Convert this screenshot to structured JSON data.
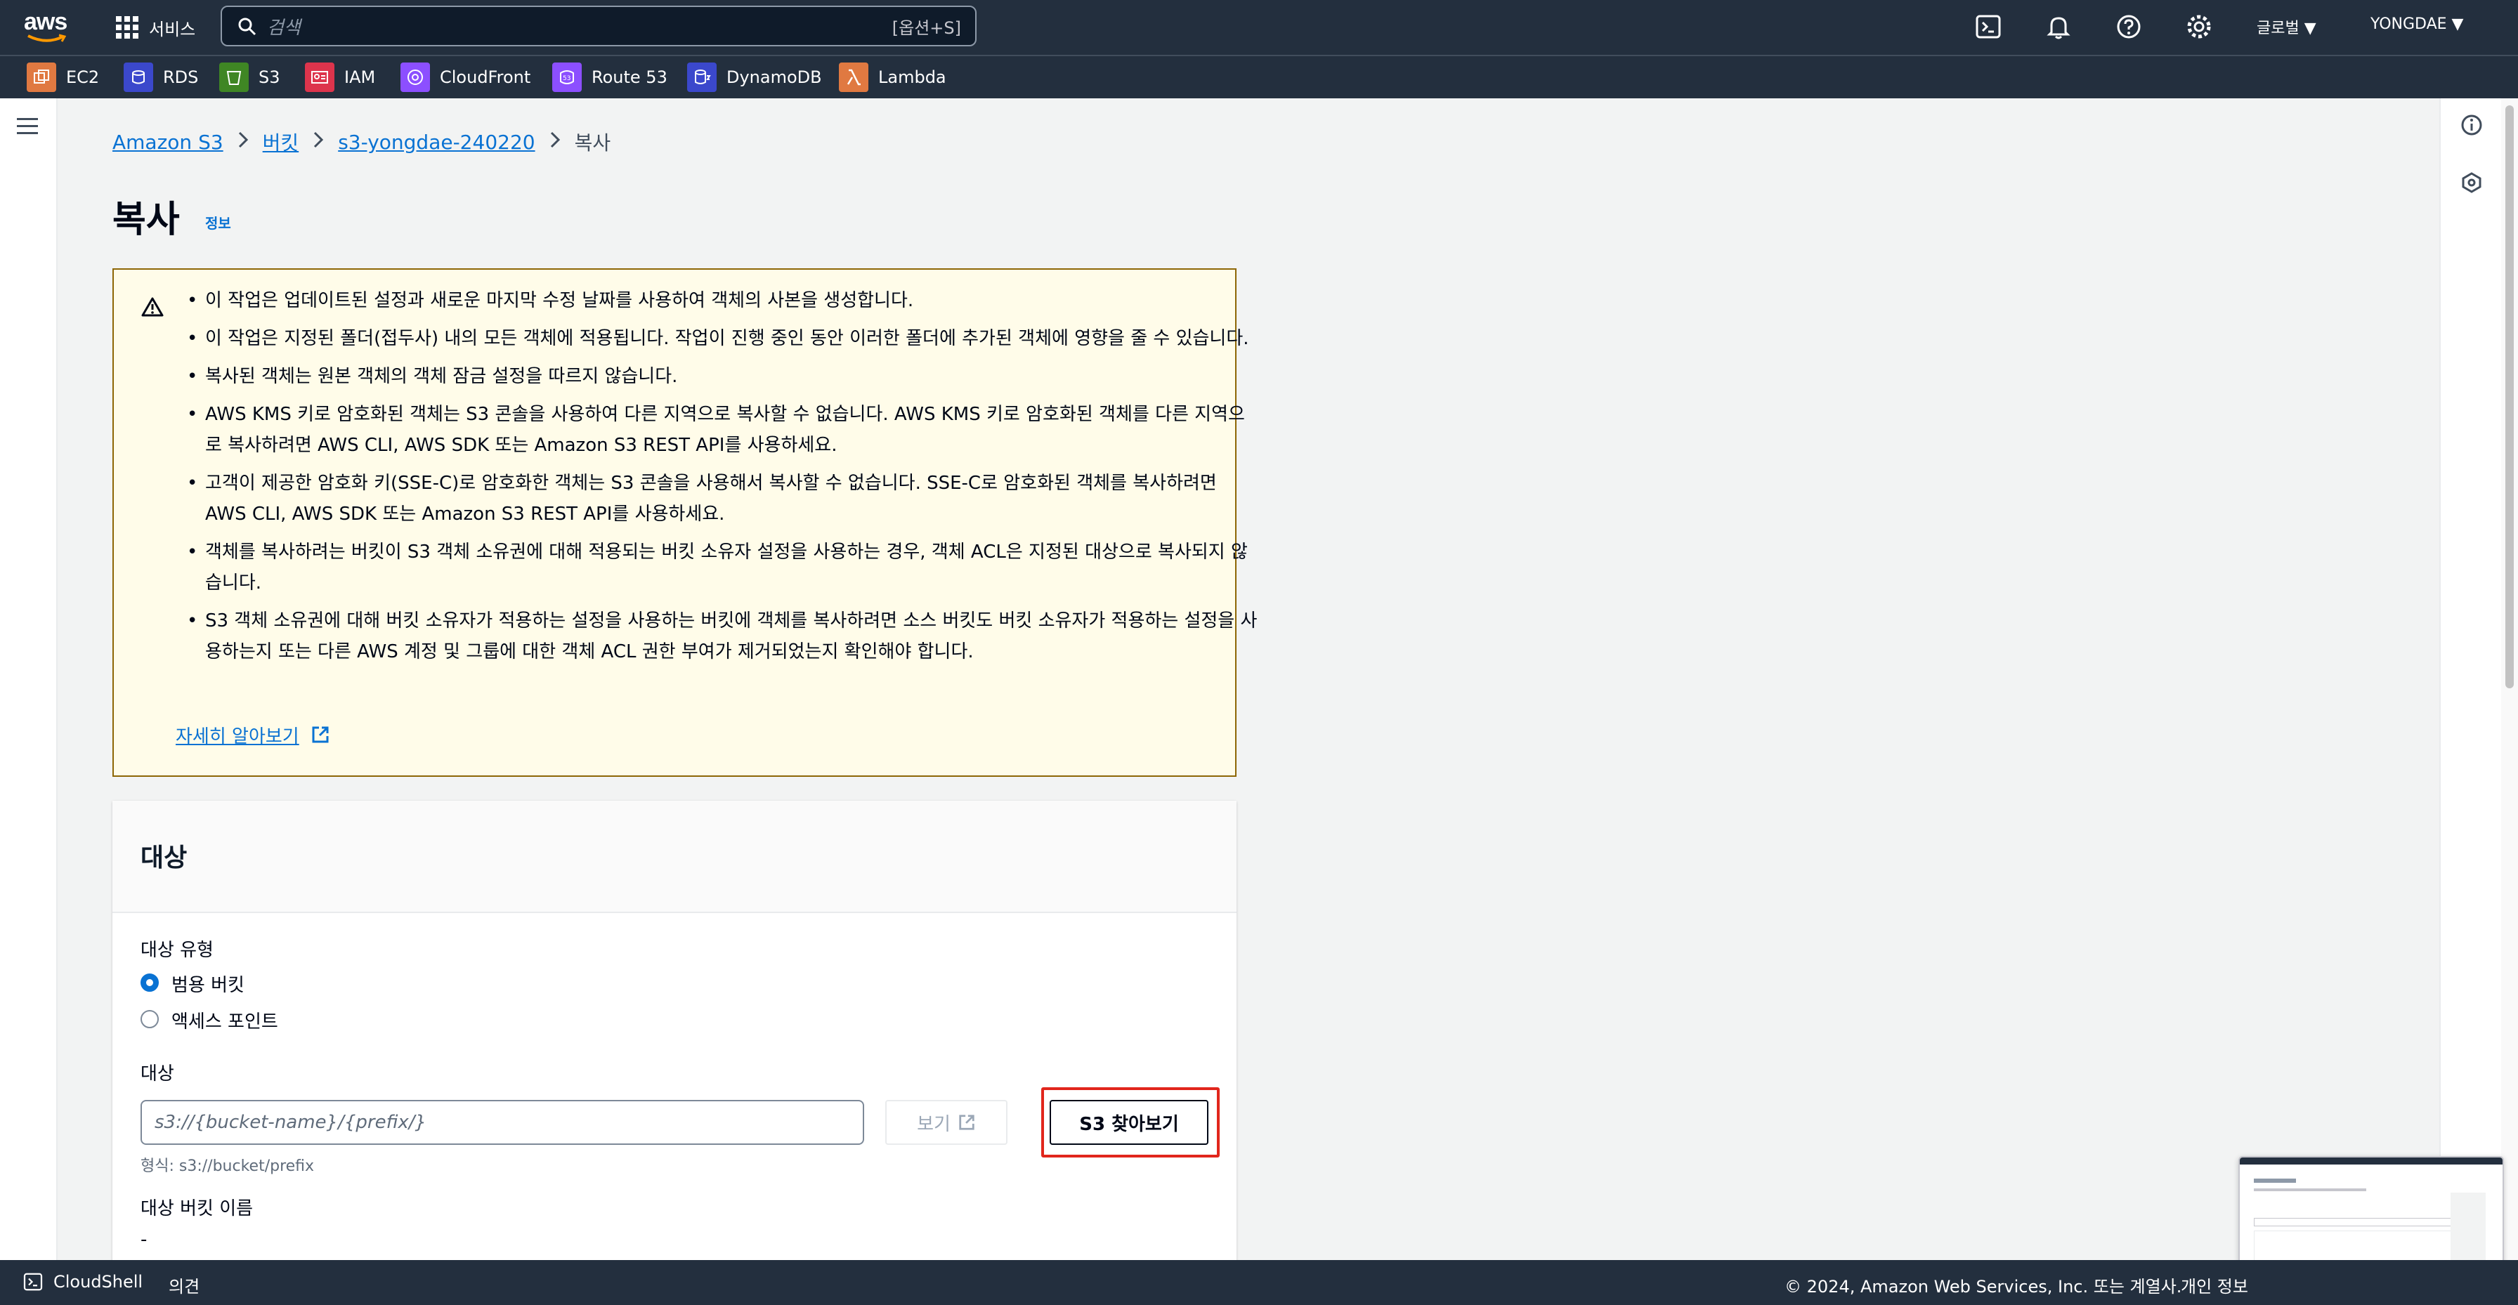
{
  "topbar": {
    "services_label": "서비스",
    "search_placeholder": "검색",
    "search_shortcut": "[옵션+S]",
    "region": "글로벌 ▼",
    "account": "YONGDAE ▼"
  },
  "favorites": [
    {
      "label": "EC2",
      "icon": "ec2-icon",
      "color": "#e07941"
    },
    {
      "label": "RDS",
      "icon": "rds-icon",
      "color": "#3b48cc"
    },
    {
      "label": "S3",
      "icon": "s3-icon",
      "color": "#3f8624"
    },
    {
      "label": "IAM",
      "icon": "iam-icon",
      "color": "#dd344c"
    },
    {
      "label": "CloudFront",
      "icon": "cloudfront-icon",
      "color": "#8c4fff"
    },
    {
      "label": "Route 53",
      "icon": "route53-icon",
      "color": "#8c4fff"
    },
    {
      "label": "DynamoDB",
      "icon": "dynamodb-icon",
      "color": "#3b48cc"
    },
    {
      "label": "Lambda",
      "icon": "lambda-icon",
      "color": "#e07941"
    }
  ],
  "breadcrumb": {
    "items": [
      "Amazon S3",
      "버킷",
      "s3-yongdae-240220"
    ],
    "current": "복사"
  },
  "page": {
    "title": "복사",
    "info": "정보"
  },
  "warning": {
    "items": [
      "이 작업은 업데이트된 설정과 새로운 마지막 수정 날짜를 사용하여 객체의 사본을 생성합니다.",
      "이 작업은 지정된 폴더(접두사) 내의 모든 객체에 적용됩니다. 작업이 진행 중인 동안 이러한 폴더에 추가된 객체에 영향을 줄 수 있습니다.",
      "복사된 객체는 원본 객체의 객체 잠금 설정을 따르지 않습니다.",
      "AWS KMS 키로 암호화된 객체는 S3 콘솔을 사용하여 다른 지역으로 복사할 수 없습니다. AWS KMS 키로 암호화된 객체를 다른 지역으로 복사하려면 AWS CLI, AWS SDK 또는 Amazon S3 REST API를 사용하세요.",
      "고객이 제공한 암호화 키(SSE-C)로 암호화한 객체는 S3 콘솔을 사용해서 복사할 수 없습니다. SSE-C로 암호화된 객체를 복사하려면 AWS CLI, AWS SDK 또는 Amazon S3 REST API를 사용하세요.",
      "객체를 복사하려는 버킷이 S3 객체 소유권에 대해 적용되는 버킷 소유자 설정을 사용하는 경우, 객체 ACL은 지정된 대상으로 복사되지 않습니다.",
      "S3 객체 소유권에 대해 버킷 소유자가 적용하는 설정을 사용하는 버킷에 객체를 복사하려면 소스 버킷도 버킷 소유자가 적용하는 설정을 사용하는지 또는 다른 AWS 계정 및 그룹에 대한 객체 ACL 권한 부여가 제거되었는지 확인해야 합니다."
    ],
    "learn_more": "자세히 알아보기"
  },
  "destination": {
    "section_title": "대상",
    "type_label": "대상 유형",
    "options": [
      "범용 버킷",
      "액세스 포인트"
    ],
    "selected_option": "범용 버킷",
    "dest_label": "대상",
    "input_placeholder": "s3://{bucket-name}/{prefix/}",
    "input_value": "",
    "view_label": "보기",
    "browse_label": "S3 찾아보기",
    "hint": "형식: s3://bucket/prefix",
    "bucket_name_label": "대상 버킷 이름",
    "bucket_name_value": "-"
  },
  "bottombar": {
    "cloudshell": "CloudShell",
    "feedback": "의견",
    "copyright": "© 2024, Amazon Web Services, Inc. 또는 계열사.",
    "privacy": "개인 정보"
  },
  "colors": {
    "nav_bg": "#232f3e",
    "link": "#0972d3",
    "warning_bg": "#fffce9",
    "warning_border": "#8d6605",
    "highlight": "#e1261c"
  }
}
